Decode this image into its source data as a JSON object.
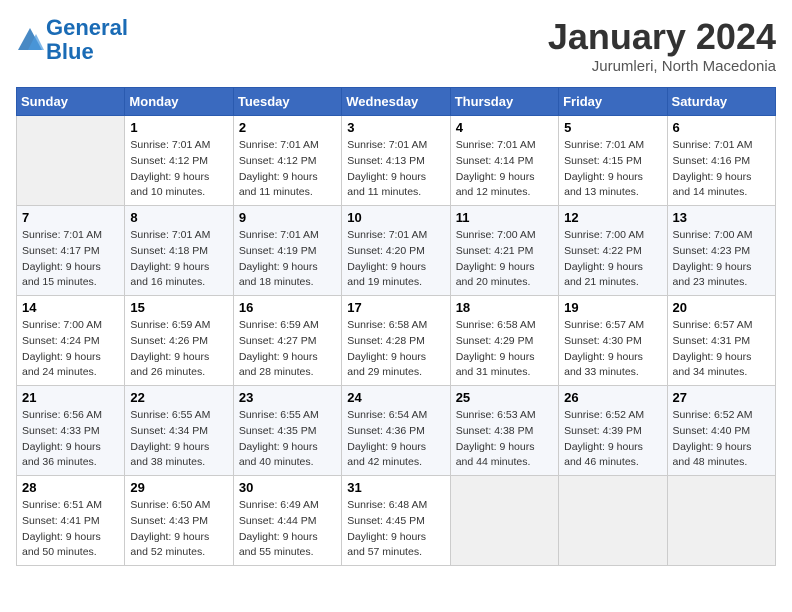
{
  "header": {
    "logo_line1": "General",
    "logo_line2": "Blue",
    "month": "January 2024",
    "location": "Jurumleri, North Macedonia"
  },
  "weekdays": [
    "Sunday",
    "Monday",
    "Tuesday",
    "Wednesday",
    "Thursday",
    "Friday",
    "Saturday"
  ],
  "weeks": [
    [
      {
        "day": "",
        "info": ""
      },
      {
        "day": "1",
        "info": "Sunrise: 7:01 AM\nSunset: 4:12 PM\nDaylight: 9 hours\nand 10 minutes."
      },
      {
        "day": "2",
        "info": "Sunrise: 7:01 AM\nSunset: 4:12 PM\nDaylight: 9 hours\nand 11 minutes."
      },
      {
        "day": "3",
        "info": "Sunrise: 7:01 AM\nSunset: 4:13 PM\nDaylight: 9 hours\nand 11 minutes."
      },
      {
        "day": "4",
        "info": "Sunrise: 7:01 AM\nSunset: 4:14 PM\nDaylight: 9 hours\nand 12 minutes."
      },
      {
        "day": "5",
        "info": "Sunrise: 7:01 AM\nSunset: 4:15 PM\nDaylight: 9 hours\nand 13 minutes."
      },
      {
        "day": "6",
        "info": "Sunrise: 7:01 AM\nSunset: 4:16 PM\nDaylight: 9 hours\nand 14 minutes."
      }
    ],
    [
      {
        "day": "7",
        "info": "Sunrise: 7:01 AM\nSunset: 4:17 PM\nDaylight: 9 hours\nand 15 minutes."
      },
      {
        "day": "8",
        "info": "Sunrise: 7:01 AM\nSunset: 4:18 PM\nDaylight: 9 hours\nand 16 minutes."
      },
      {
        "day": "9",
        "info": "Sunrise: 7:01 AM\nSunset: 4:19 PM\nDaylight: 9 hours\nand 18 minutes."
      },
      {
        "day": "10",
        "info": "Sunrise: 7:01 AM\nSunset: 4:20 PM\nDaylight: 9 hours\nand 19 minutes."
      },
      {
        "day": "11",
        "info": "Sunrise: 7:00 AM\nSunset: 4:21 PM\nDaylight: 9 hours\nand 20 minutes."
      },
      {
        "day": "12",
        "info": "Sunrise: 7:00 AM\nSunset: 4:22 PM\nDaylight: 9 hours\nand 21 minutes."
      },
      {
        "day": "13",
        "info": "Sunrise: 7:00 AM\nSunset: 4:23 PM\nDaylight: 9 hours\nand 23 minutes."
      }
    ],
    [
      {
        "day": "14",
        "info": "Sunrise: 7:00 AM\nSunset: 4:24 PM\nDaylight: 9 hours\nand 24 minutes."
      },
      {
        "day": "15",
        "info": "Sunrise: 6:59 AM\nSunset: 4:26 PM\nDaylight: 9 hours\nand 26 minutes."
      },
      {
        "day": "16",
        "info": "Sunrise: 6:59 AM\nSunset: 4:27 PM\nDaylight: 9 hours\nand 28 minutes."
      },
      {
        "day": "17",
        "info": "Sunrise: 6:58 AM\nSunset: 4:28 PM\nDaylight: 9 hours\nand 29 minutes."
      },
      {
        "day": "18",
        "info": "Sunrise: 6:58 AM\nSunset: 4:29 PM\nDaylight: 9 hours\nand 31 minutes."
      },
      {
        "day": "19",
        "info": "Sunrise: 6:57 AM\nSunset: 4:30 PM\nDaylight: 9 hours\nand 33 minutes."
      },
      {
        "day": "20",
        "info": "Sunrise: 6:57 AM\nSunset: 4:31 PM\nDaylight: 9 hours\nand 34 minutes."
      }
    ],
    [
      {
        "day": "21",
        "info": "Sunrise: 6:56 AM\nSunset: 4:33 PM\nDaylight: 9 hours\nand 36 minutes."
      },
      {
        "day": "22",
        "info": "Sunrise: 6:55 AM\nSunset: 4:34 PM\nDaylight: 9 hours\nand 38 minutes."
      },
      {
        "day": "23",
        "info": "Sunrise: 6:55 AM\nSunset: 4:35 PM\nDaylight: 9 hours\nand 40 minutes."
      },
      {
        "day": "24",
        "info": "Sunrise: 6:54 AM\nSunset: 4:36 PM\nDaylight: 9 hours\nand 42 minutes."
      },
      {
        "day": "25",
        "info": "Sunrise: 6:53 AM\nSunset: 4:38 PM\nDaylight: 9 hours\nand 44 minutes."
      },
      {
        "day": "26",
        "info": "Sunrise: 6:52 AM\nSunset: 4:39 PM\nDaylight: 9 hours\nand 46 minutes."
      },
      {
        "day": "27",
        "info": "Sunrise: 6:52 AM\nSunset: 4:40 PM\nDaylight: 9 hours\nand 48 minutes."
      }
    ],
    [
      {
        "day": "28",
        "info": "Sunrise: 6:51 AM\nSunset: 4:41 PM\nDaylight: 9 hours\nand 50 minutes."
      },
      {
        "day": "29",
        "info": "Sunrise: 6:50 AM\nSunset: 4:43 PM\nDaylight: 9 hours\nand 52 minutes."
      },
      {
        "day": "30",
        "info": "Sunrise: 6:49 AM\nSunset: 4:44 PM\nDaylight: 9 hours\nand 55 minutes."
      },
      {
        "day": "31",
        "info": "Sunrise: 6:48 AM\nSunset: 4:45 PM\nDaylight: 9 hours\nand 57 minutes."
      },
      {
        "day": "",
        "info": ""
      },
      {
        "day": "",
        "info": ""
      },
      {
        "day": "",
        "info": ""
      }
    ]
  ]
}
